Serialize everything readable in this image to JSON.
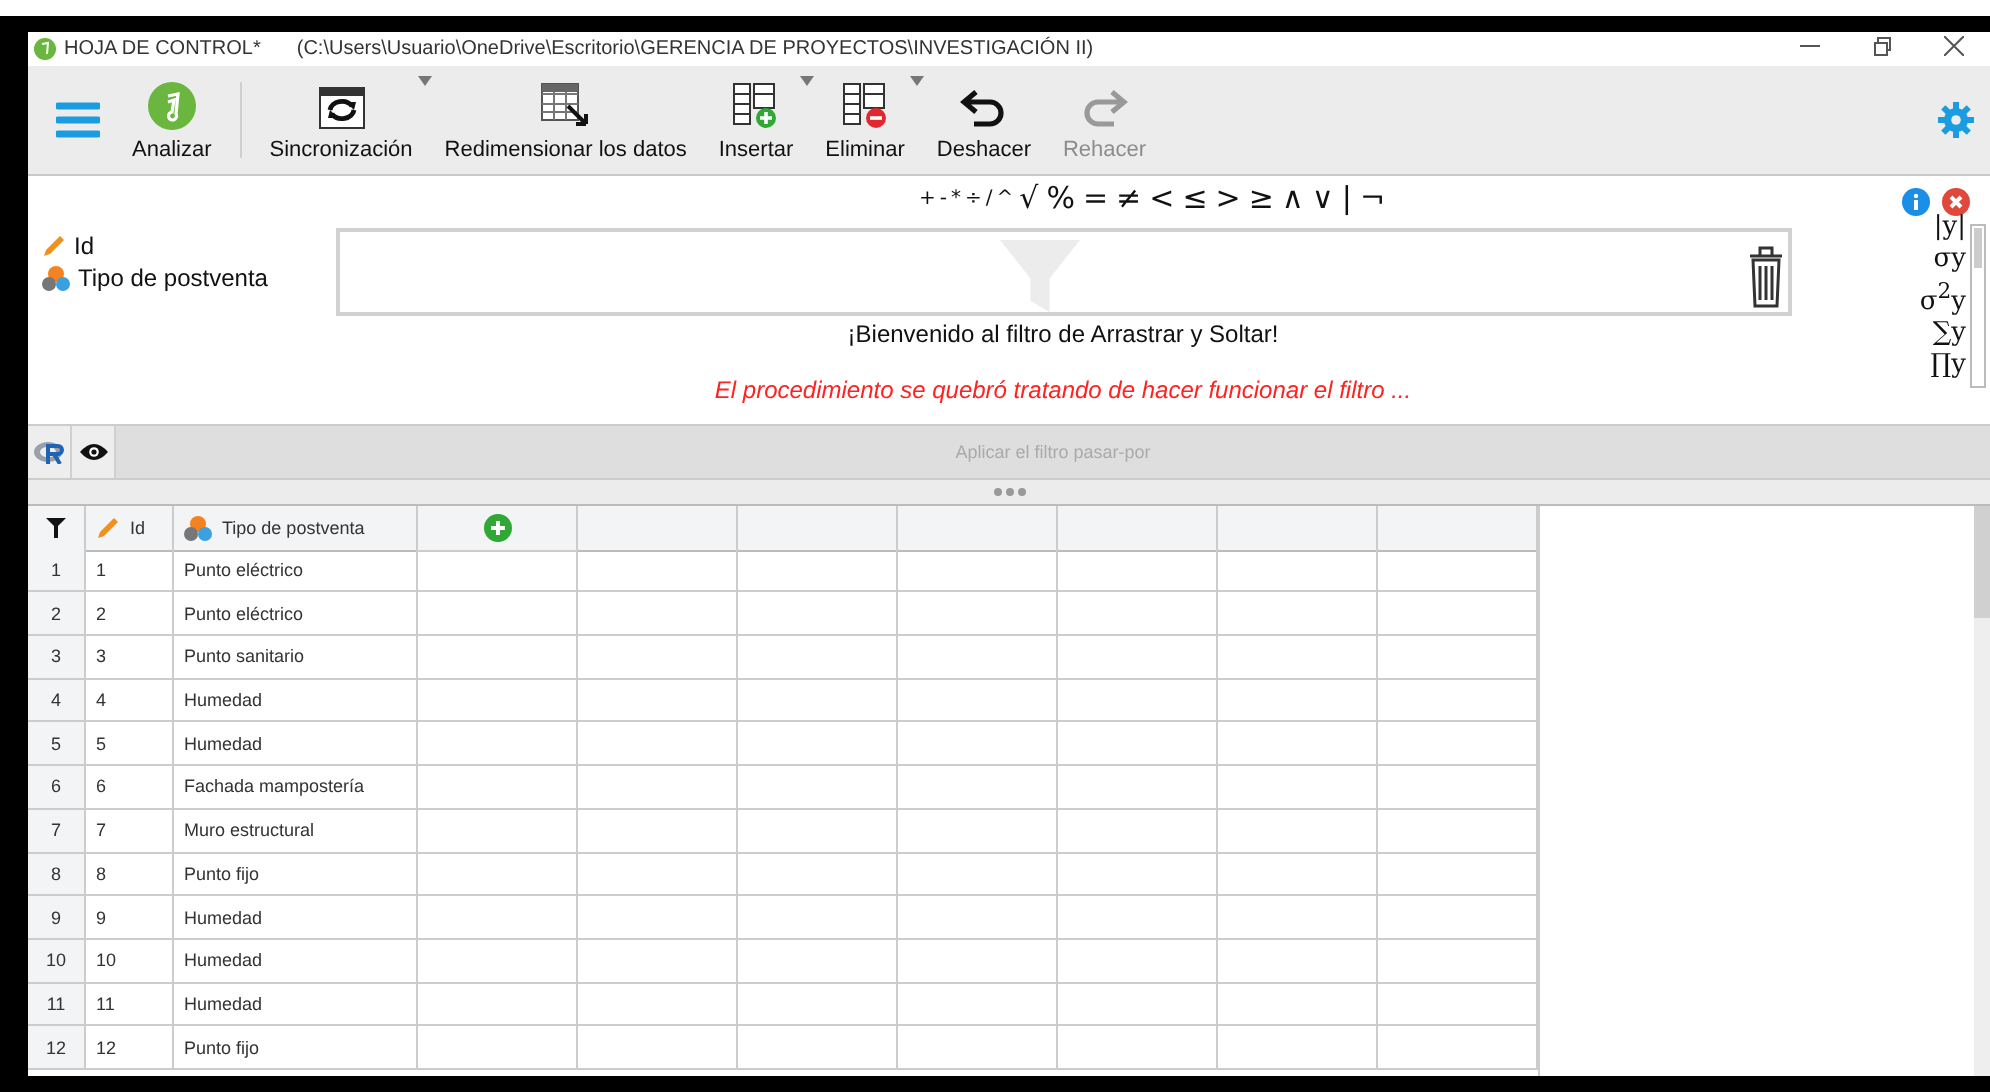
{
  "window": {
    "title": "HOJA DE CONTROL*",
    "path": "(C:\\Users\\Usuario\\OneDrive\\Escritorio\\GERENCIA DE PROYECTOS\\INVESTIGACIÓN II)"
  },
  "toolbar": [
    {
      "kind": "analyze",
      "label": "Analizar",
      "dropdown": false,
      "disabled": false
    },
    {
      "kind": "sync",
      "label": "Sincronización",
      "dropdown": true,
      "disabled": false
    },
    {
      "kind": "resize",
      "label": "Redimensionar los datos",
      "dropdown": false,
      "disabled": false
    },
    {
      "kind": "insert",
      "label": "Insertar",
      "dropdown": true,
      "disabled": false
    },
    {
      "kind": "delete",
      "label": "Eliminar",
      "dropdown": true,
      "disabled": false
    },
    {
      "kind": "undo",
      "label": "Deshacer",
      "dropdown": false,
      "disabled": false
    },
    {
      "kind": "redo",
      "label": "Rehacer",
      "dropdown": false,
      "disabled": true
    }
  ],
  "operators": [
    "+",
    "-",
    "*",
    "÷",
    "/",
    "^",
    "√",
    "%",
    "=",
    "≠",
    "<",
    "≤",
    ">",
    "≥",
    "∧",
    "∨",
    "|",
    "¬"
  ],
  "variables": [
    {
      "kind": "id",
      "label": "Id"
    },
    {
      "kind": "category",
      "label": "Tipo de postventa"
    }
  ],
  "functions": [
    "|y|",
    "σy",
    "σ$^{2}$y",
    "∑y",
    "∏y"
  ],
  "filter": {
    "welcome": "¡Bienvenido al filtro de Arrastrar y Soltar!",
    "error": "El procedimiento se quebró tratando de hacer funcionar el filtro ...",
    "apply_button": "Aplicar el filtro pasar-por",
    "apply_disabled": true
  },
  "table": {
    "columns": [
      {
        "kind": "id",
        "label": "Id"
      },
      {
        "kind": "category",
        "label": "Tipo de postventa"
      }
    ],
    "rows": [
      {
        "index": "1",
        "id": "1",
        "tipo": "Punto eléctrico"
      },
      {
        "index": "2",
        "id": "2",
        "tipo": "Punto eléctrico"
      },
      {
        "index": "3",
        "id": "3",
        "tipo": "Punto sanitario"
      },
      {
        "index": "4",
        "id": "4",
        "tipo": "Humedad"
      },
      {
        "index": "5",
        "id": "5",
        "tipo": "Humedad"
      },
      {
        "index": "6",
        "id": "6",
        "tipo": "Fachada mampostería"
      },
      {
        "index": "7",
        "id": "7",
        "tipo": "Muro estructural"
      },
      {
        "index": "8",
        "id": "8",
        "tipo": "Punto fijo"
      },
      {
        "index": "9",
        "id": "9",
        "tipo": "Humedad"
      },
      {
        "index": "10",
        "id": "10",
        "tipo": "Humedad"
      },
      {
        "index": "11",
        "id": "11",
        "tipo": "Humedad"
      },
      {
        "index": "12",
        "id": "12",
        "tipo": "Punto fijo"
      }
    ]
  }
}
